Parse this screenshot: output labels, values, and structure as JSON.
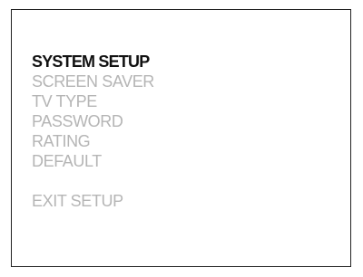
{
  "menu": {
    "items": [
      {
        "label": "SYSTEM SETUP",
        "selected": true
      },
      {
        "label": "SCREEN SAVER",
        "selected": false
      },
      {
        "label": "TV TYPE",
        "selected": false
      },
      {
        "label": "PASSWORD",
        "selected": false
      },
      {
        "label": "RATING",
        "selected": false
      },
      {
        "label": "DEFAULT",
        "selected": false
      }
    ],
    "exit_label": "EXIT SETUP"
  },
  "colors": {
    "selected_text": "#111111",
    "unselected_text": "#b5b5b5",
    "border": "#222222",
    "background": "#ffffff"
  }
}
